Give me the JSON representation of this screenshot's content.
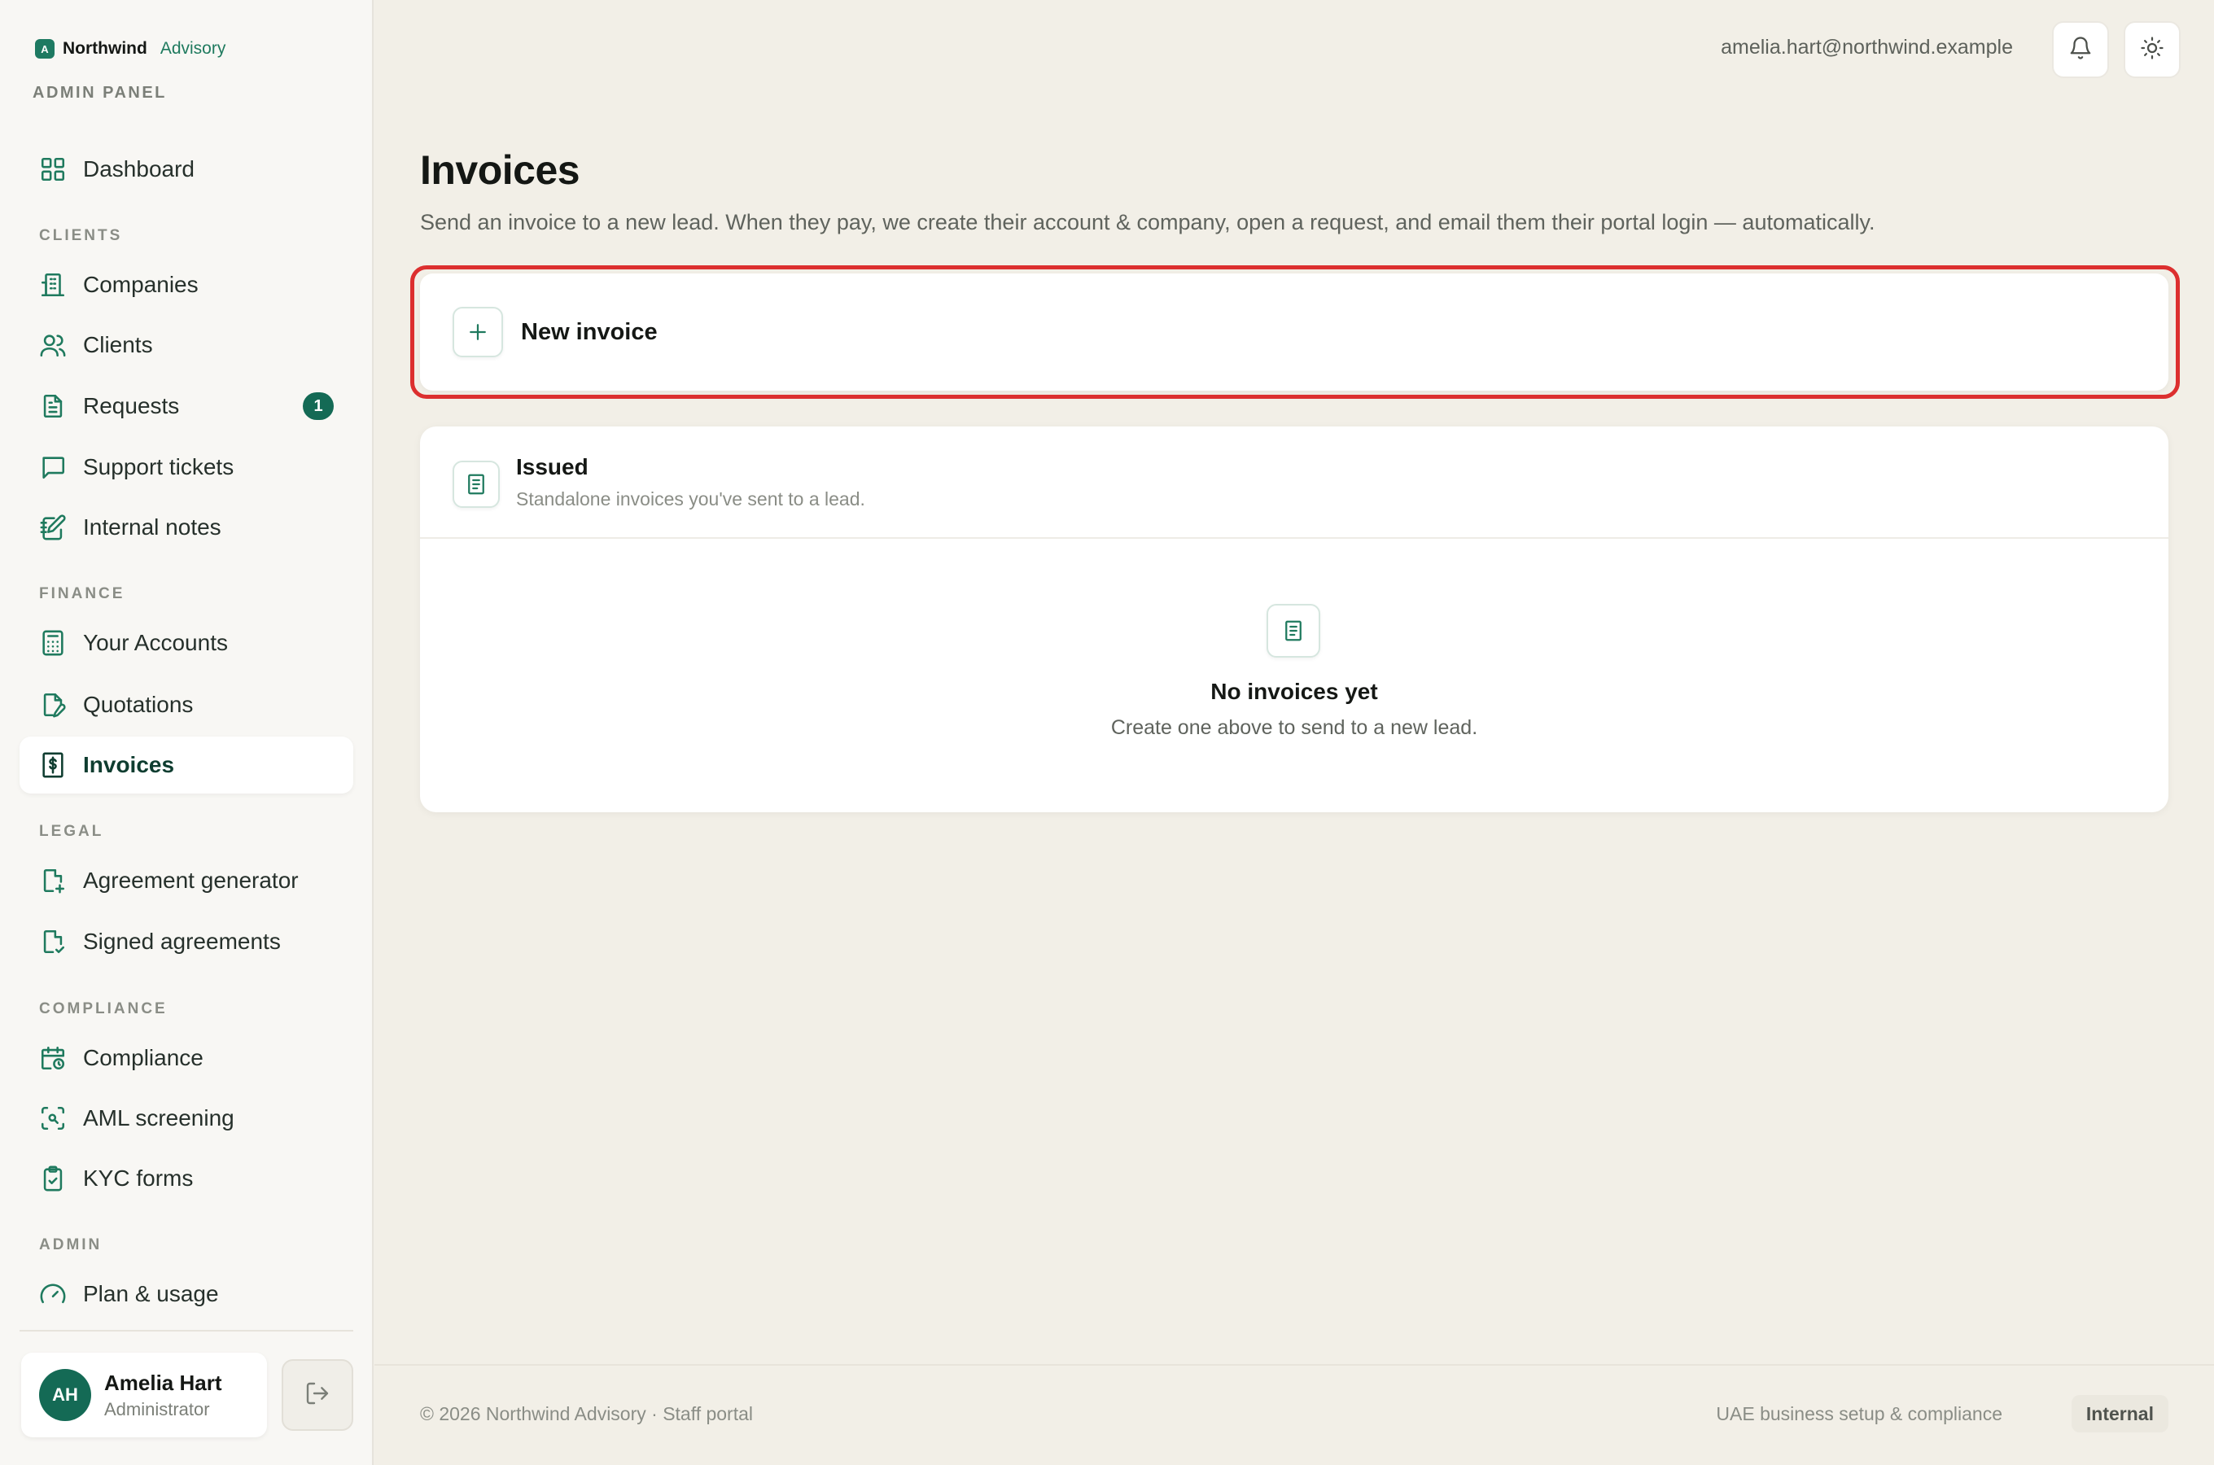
{
  "brand": {
    "name": "Northwind",
    "sub": "Advisory",
    "mark": "A"
  },
  "panel_label": "ADMIN PANEL",
  "nav": {
    "dashboard": "Dashboard",
    "sections": {
      "clients": "CLIENTS",
      "finance": "FINANCE",
      "legal": "LEGAL",
      "compliance": "COMPLIANCE",
      "admin": "ADMIN"
    },
    "companies": "Companies",
    "clients": "Clients",
    "requests": "Requests",
    "requests_badge": "1",
    "support_tickets": "Support tickets",
    "internal_notes": "Internal notes",
    "your_accounts": "Your Accounts",
    "quotations": "Quotations",
    "invoices": "Invoices",
    "agreement_generator": "Agreement generator",
    "signed_agreements": "Signed agreements",
    "compliance": "Compliance",
    "aml_screening": "AML screening",
    "kyc_forms": "KYC forms",
    "plan_usage": "Plan & usage"
  },
  "user": {
    "initials": "AH",
    "name": "Amelia Hart",
    "role": "Administrator"
  },
  "topbar": {
    "email": "amelia.hart@northwind.example"
  },
  "page": {
    "title": "Invoices",
    "description": "Send an invoice to a new lead. When they pay, we create their account & company, open a request, and email them their portal login — automatically."
  },
  "new_invoice": {
    "label": "New invoice"
  },
  "issued": {
    "title": "Issued",
    "subtitle": "Standalone invoices you've sent to a lead.",
    "empty_title": "No invoices yet",
    "empty_subtitle": "Create one above to send to a new lead."
  },
  "footer": {
    "left": "© 2026 Northwind Advisory · Staff portal",
    "right": "UAE business setup & compliance",
    "tag": "Internal"
  },
  "colors": {
    "accent": "#1f7a5e",
    "highlight": "#dc2f2f",
    "badge": "#146a55"
  }
}
